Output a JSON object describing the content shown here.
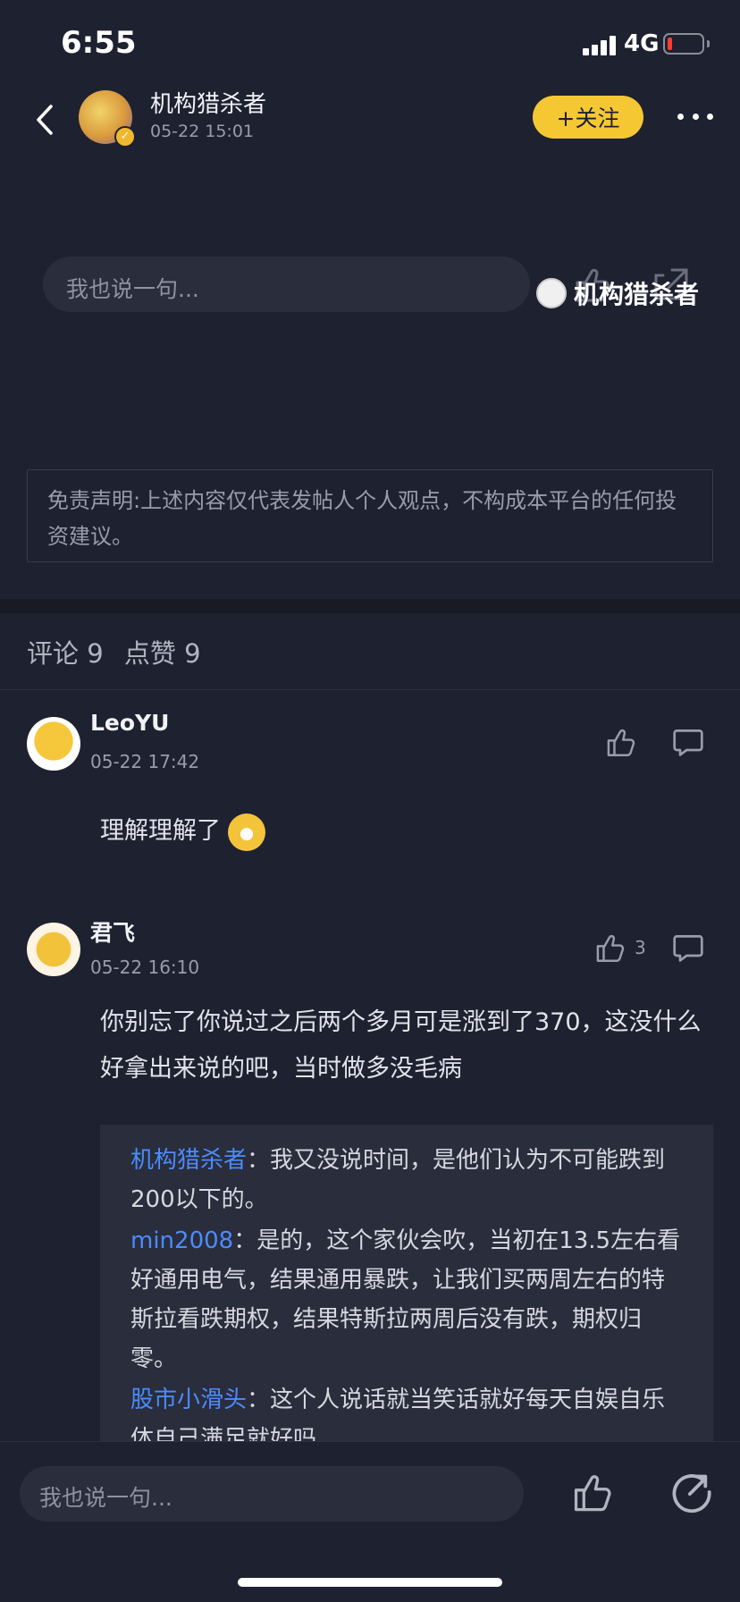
{
  "status_bar": {
    "time": "6:55",
    "network": "4G"
  },
  "header": {
    "author_name": "机构猎杀者",
    "post_time": "05-22 15:01",
    "follow_label": "+关注"
  },
  "inline_comment": {
    "placeholder": "我也说一句..."
  },
  "watermark": {
    "text": "机构猎杀者"
  },
  "disclaimer": {
    "text": "免责声明:上述内容仅代表发帖人个人观点，不构成本平台的任何投资建议。"
  },
  "stats": {
    "comments_label": "评论 9",
    "likes_label": "点赞 9"
  },
  "comments": [
    {
      "name": "LeoYU",
      "time": "05-22 17:42",
      "body": "理解理解了",
      "likes": ""
    },
    {
      "name": "君飞",
      "time": "05-22 16:10",
      "body": "你别忘了你说过之后两个多月可是涨到了370，这没什么好拿出来说的吧，当时做多没毛病",
      "likes": "3",
      "replies": [
        {
          "author": "机构猎杀者",
          "text": "：我又没说时间，是他们认为不可能跌到200以下的。"
        },
        {
          "author": "min2008",
          "text": "：是的，这个家伙会吹，当初在13.5左右看好通用电气，结果通用暴跌，让我们买两周左右的特斯拉看跌期权，结果特斯拉两周后没有跌，期权归零。"
        },
        {
          "author": "股市小滑头",
          "text": "：这个人说话就当笑话就好每天自娱自乐 体自己满足就好吗"
        }
      ]
    }
  ],
  "bottom_bar": {
    "placeholder": "我也说一句..."
  },
  "colors": {
    "accent": "#f5c833",
    "background": "#1e2130",
    "link": "#4a8cff"
  }
}
